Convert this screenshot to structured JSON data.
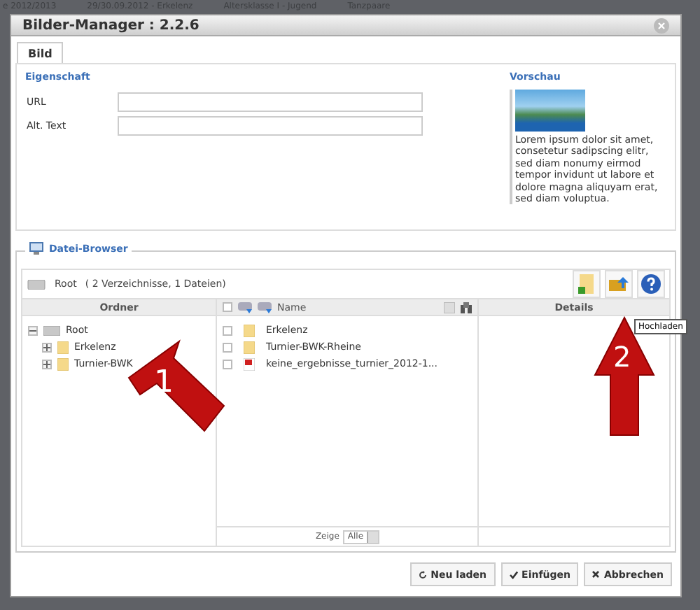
{
  "background": {
    "breadcrumbs": [
      "e 2012/2013",
      "29/30.09.2012 - Erkelenz",
      "Altersklasse I - Jugend",
      "Tanzpaare"
    ]
  },
  "dialog": {
    "title": "Bilder-Manager : 2.2.6",
    "tabs": [
      {
        "label": "Bild",
        "selected": true
      }
    ],
    "properties": {
      "heading": "Eigenschaft",
      "fields": [
        {
          "label": "URL"
        },
        {
          "label": "Alt. Text"
        }
      ]
    },
    "preview": {
      "heading": "Vorschau",
      "text": "Lorem ipsum dolor sit amet, consetetur sadipscing elitr, sed diam nonumy eirmod tempor invidunt ut labore et dolore magna aliquyam erat, sed diam voluptua."
    },
    "browser": {
      "legend": "Datei-Browser",
      "path": "Root",
      "summary": "( 2 Verzeichnisse, 1 Dateien)",
      "tooltip": "Hochladen",
      "folders_heading": "Ordner",
      "tree": {
        "label": "Root",
        "expanded": true,
        "children": [
          {
            "label": "Erkelenz",
            "expanded": false
          },
          {
            "label": "Turnier-BWK",
            "expanded": false
          }
        ]
      },
      "list_heading": "Name",
      "select_all_checked": false,
      "files": [
        {
          "name": "Erkelenz",
          "kind": "folder",
          "checked": false
        },
        {
          "name": "Turnier-BWK-Rheine",
          "kind": "folder",
          "checked": false
        },
        {
          "name": "keine_ergebnisse_turnier_2012-1...",
          "kind": "pdf",
          "checked": false
        }
      ],
      "details_heading": "Details",
      "filter_label": "Zeige",
      "filter_value": "Alle"
    },
    "buttons": [
      {
        "label": "Neu laden",
        "kind": "reload"
      },
      {
        "label": "Einfügen",
        "kind": "insert"
      },
      {
        "label": "Abbrechen",
        "kind": "cancel"
      }
    ]
  },
  "annotations": [
    {
      "label": "1",
      "kind": "diagonal"
    },
    {
      "label": "2",
      "kind": "up"
    }
  ]
}
